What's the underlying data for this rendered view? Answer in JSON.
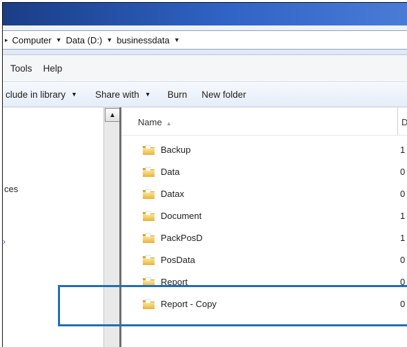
{
  "address_bar": {
    "crumbs": [
      "Computer",
      "Data (D:)",
      "businessdata"
    ]
  },
  "menu_bar": {
    "items": [
      "Tools",
      "Help"
    ]
  },
  "toolbar": {
    "include_label": "clude in library",
    "share_label": "Share with",
    "burn_label": "Burn",
    "new_folder_label": "New folder"
  },
  "nav_pane": {
    "fragment_1": "ces"
  },
  "file_list": {
    "column_name": "Name",
    "column_date": "D",
    "items": [
      {
        "name": "Backup",
        "date": "1"
      },
      {
        "name": "Data",
        "date": "0"
      },
      {
        "name": "Datax",
        "date": "0"
      },
      {
        "name": "Document",
        "date": "1"
      },
      {
        "name": "PackPosD",
        "date": "1"
      },
      {
        "name": "PosData",
        "date": "0"
      },
      {
        "name": "Report",
        "date": "0"
      },
      {
        "name": "Report - Copy",
        "date": "0"
      }
    ]
  },
  "icons": {
    "folder": "folder-icon",
    "dropdown": "chevron-down-icon",
    "sort": "sort-ascending-icon",
    "scroll_up": "scroll-up-arrow-icon"
  },
  "colors": {
    "title_bar": "#2f63c5",
    "highlight_border": "#1f6db8",
    "folder_yellow": "#f2c94c"
  }
}
